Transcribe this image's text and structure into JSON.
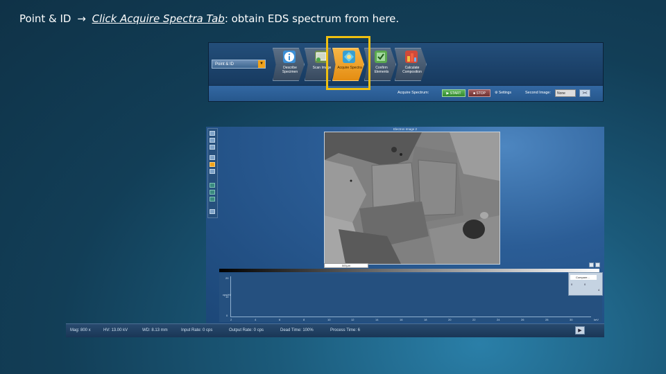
{
  "caption": {
    "prefix": "Point & ID",
    "arrow": "→",
    "link": "Click Acquire Spectra Tab",
    "suffix": ": obtain EDS spectrum from here."
  },
  "toolbar": {
    "project_select": "Point & ID",
    "steps": [
      {
        "label": "Describe Specimen",
        "icon": "info-icon",
        "color": "#3b8fd6",
        "active": false
      },
      {
        "label": "Scan Image",
        "icon": "scan-image-icon",
        "color": "#6c8c4c",
        "active": false
      },
      {
        "label": "Acquire Spectra",
        "icon": "acquire-spectra-icon",
        "color": "#3a9fd0",
        "active": true
      },
      {
        "label": "Confirm Elements",
        "icon": "confirm-elements-icon",
        "color": "#5aa94f",
        "active": false
      },
      {
        "label": "Calculate Composition",
        "icon": "composition-icon",
        "color": "#d04a3a",
        "active": false
      }
    ],
    "acquire_label": "Acquire Spectrum:",
    "start_label": "▶ START",
    "stop_label": "■ STOP",
    "settings_label": "⚙ Settings",
    "second_image_label": "Second Image:",
    "second_image_value": "None",
    "second_image_btn": "><"
  },
  "app": {
    "image_title": "Electron Image 2",
    "scalebar": "500µm",
    "spectrum": {
      "y_ticks": [
        "20",
        "10",
        "0"
      ],
      "y_label": "cps/eV",
      "x_ticks": [
        "2",
        "4",
        "6",
        "8",
        "10",
        "12",
        "14",
        "16",
        "18",
        "20",
        "22",
        "24",
        "26",
        "28",
        "30"
      ],
      "x_unit": "keV",
      "legend_item": "Compare..."
    }
  },
  "status": {
    "mag": "Mag: 800 x",
    "hv": "HV: 13.00 kV",
    "wd": "WD: 8.13 mm",
    "input_rate": "Input Rate: 0 cps",
    "output_rate": "Output Rate: 0 cps",
    "dead_time": "Dead Time: 100%",
    "process_time": "Process Time: 6"
  },
  "colors": {
    "highlight": "#f0c010",
    "active_tab": "#f0a21a",
    "background": "#123e57"
  }
}
